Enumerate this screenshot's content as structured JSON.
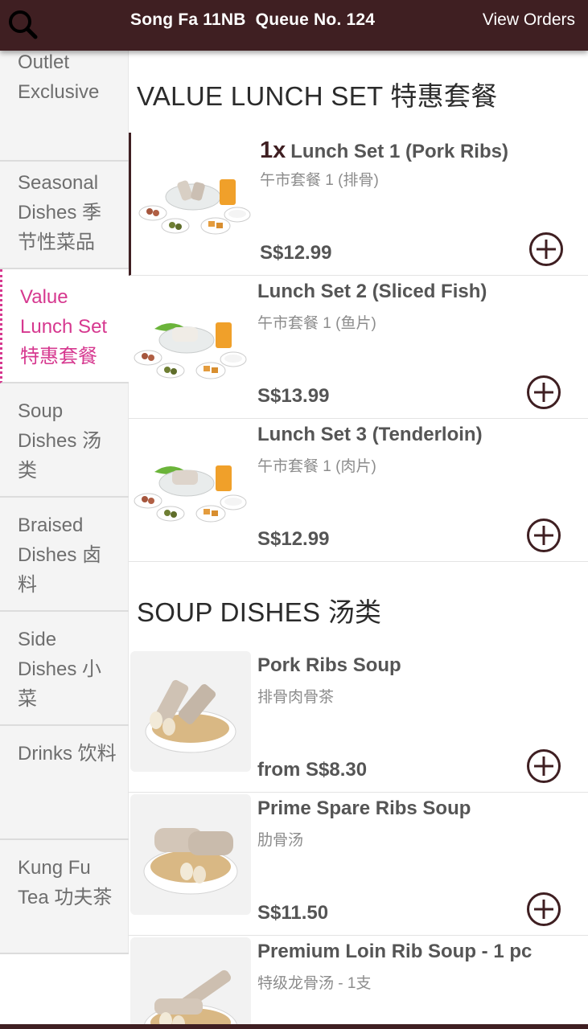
{
  "header": {
    "title": "Song Fa 11NB  Queue No. 124",
    "view_orders": "View Orders"
  },
  "colors": {
    "brand": "#3f1f22",
    "active_category": "#d6388f"
  },
  "sidebar": {
    "items": [
      {
        "label": "Outlet Exclusive"
      },
      {
        "label": "Seasonal Dishes 季节性菜品"
      },
      {
        "label": "Value Lunch Set 特惠套餐",
        "active": true
      },
      {
        "label": "Soup Dishes 汤类"
      },
      {
        "label": "Braised Dishes 卤料"
      },
      {
        "label": "Side Dishes 小菜"
      },
      {
        "label": "Drinks 饮料"
      },
      {
        "label": "Kung Fu Tea 功夫茶"
      }
    ]
  },
  "sections": [
    {
      "title": "VALUE LUNCH SET 特惠套餐",
      "items": [
        {
          "qty": "1x",
          "name": "Lunch Set 1 (Pork Ribs)",
          "sub": "午市套餐 1 (排骨)",
          "price": "S$12.99",
          "icon": "add-circle-icon"
        },
        {
          "qty": "",
          "name": "Lunch Set 2 (Sliced Fish)",
          "sub": "午市套餐 1 (鱼片)",
          "price": "S$13.99",
          "icon": "add-circle-icon"
        },
        {
          "qty": "",
          "name": "Lunch Set 3 (Tenderloin)",
          "sub": "午市套餐 1 (肉片)",
          "price": "S$12.99",
          "icon": "add-circle-icon"
        }
      ]
    },
    {
      "title": "SOUP DISHES 汤类",
      "items": [
        {
          "qty": "",
          "name": "Pork Ribs Soup",
          "sub": "排骨肉骨茶",
          "price": "from S$8.30",
          "icon": "add-circle-icon"
        },
        {
          "qty": "",
          "name": "Prime Spare Ribs Soup",
          "sub": "肋骨汤",
          "price": "S$11.50",
          "icon": "add-circle-icon"
        },
        {
          "qty": "",
          "name": "Premium Loin Rib Soup - 1 pc",
          "sub": "特级龙骨汤 - 1支",
          "price": "",
          "icon": "add-circle-icon"
        }
      ]
    }
  ]
}
